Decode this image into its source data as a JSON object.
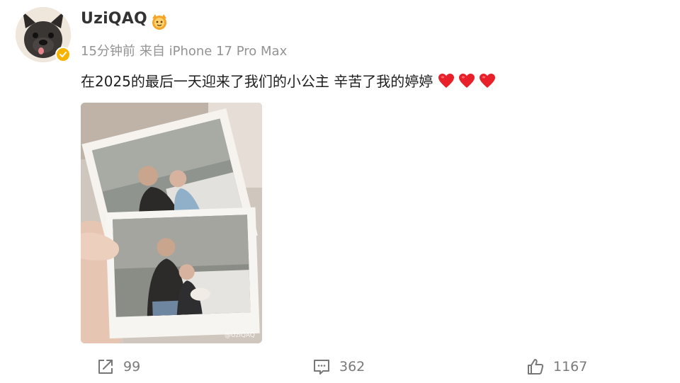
{
  "user": {
    "name": "UziQAQ",
    "verified_color": "#f6b400"
  },
  "meta": {
    "time": "15分钟前",
    "source": "来自 iPhone 17 Pro Max"
  },
  "post": {
    "text": "在2025的最后一天迎来了我们的小公主 辛苦了我的婷婷",
    "hearts": [
      "heart-icon",
      "heart-icon",
      "heart-icon"
    ],
    "heart_color": "#e8202a"
  },
  "photo": {
    "watermark": "@UziQAQ"
  },
  "actions": {
    "repost_count": "99",
    "comment_count": "362",
    "like_count": "1167"
  }
}
